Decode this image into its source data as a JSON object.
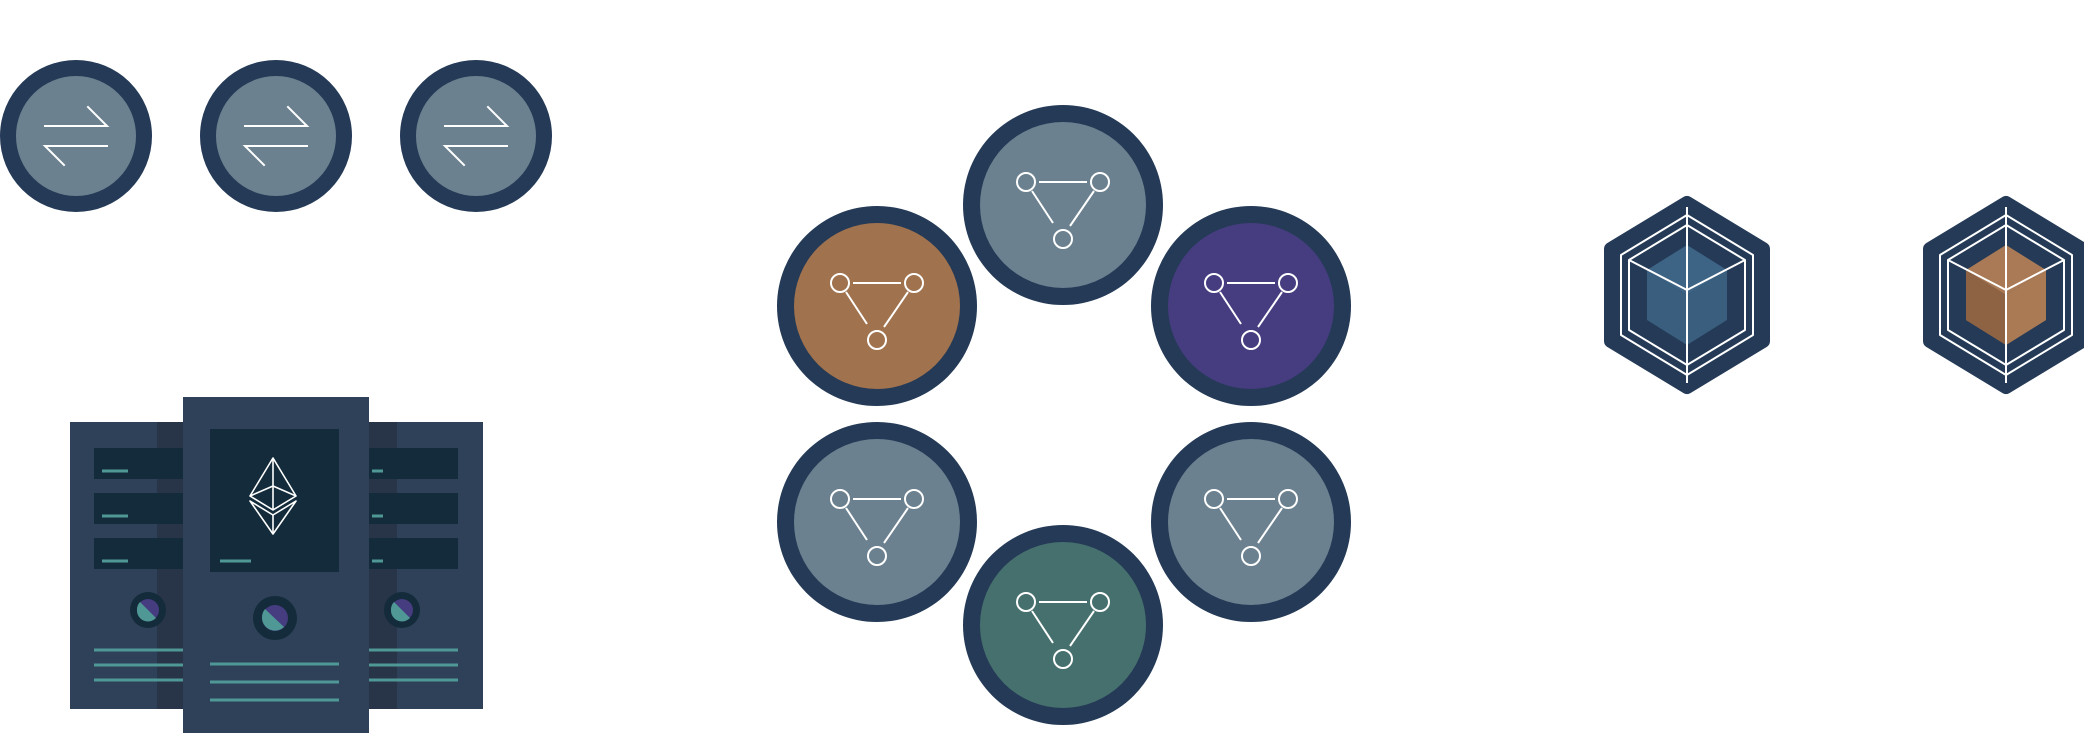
{
  "colors": {
    "outline": "#243a56",
    "slate": "#6b8190",
    "copper": "#a0724e",
    "purple": "#463c80",
    "teal": "#46706e",
    "server_body": "#2e4159",
    "server_shade": "#283448",
    "server_screen": "#132b3a",
    "server_accent": "#4f9896",
    "cube_blue": "#3e6485",
    "cube_blue_light": "#3a5e7e",
    "cube_copper": "#a97a55",
    "cube_copper_dark": "#8b6141",
    "line": "#ffffff"
  },
  "transfer_icons": [
    {
      "icon": "exchange-arrows-icon",
      "fill": "slate"
    },
    {
      "icon": "exchange-arrows-icon",
      "fill": "slate"
    },
    {
      "icon": "exchange-arrows-icon",
      "fill": "slate"
    }
  ],
  "servers": {
    "center_icon": "ethereum-icon",
    "side_units": 2
  },
  "node_ring": [
    {
      "icon": "network-triangle-icon",
      "fill": "slate",
      "position": "top"
    },
    {
      "icon": "network-triangle-icon",
      "fill": "purple",
      "position": "upper-right"
    },
    {
      "icon": "network-triangle-icon",
      "fill": "slate",
      "position": "lower-right"
    },
    {
      "icon": "network-triangle-icon",
      "fill": "teal",
      "position": "bottom"
    },
    {
      "icon": "network-triangle-icon",
      "fill": "slate",
      "position": "lower-left"
    },
    {
      "icon": "network-triangle-icon",
      "fill": "copper",
      "position": "upper-left"
    }
  ],
  "cubes": [
    {
      "icon": "hex-cube-icon",
      "fill": "blue"
    },
    {
      "icon": "hex-cube-icon",
      "fill": "copper"
    }
  ]
}
